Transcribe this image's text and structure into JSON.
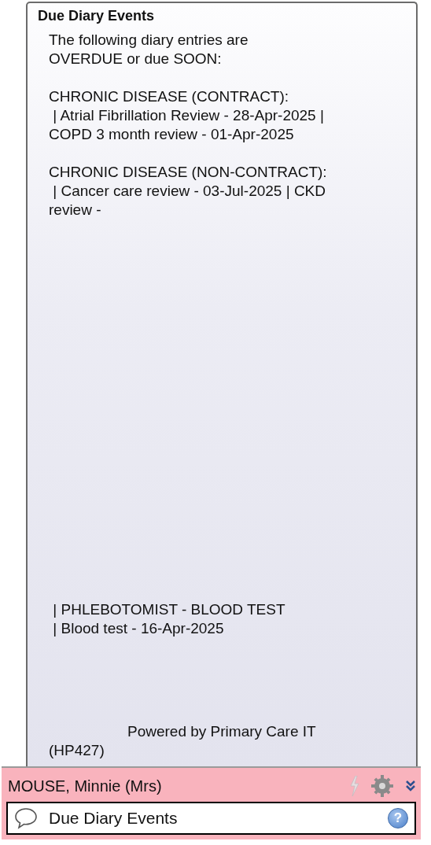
{
  "popup": {
    "title": "Due Diary Events",
    "sections": [
      {
        "lines": [
          "The following diary entries are",
          "OVERDUE or due SOON:"
        ]
      },
      {
        "lines": [
          "CHRONIC DISEASE (CONTRACT):",
          " | Atrial Fibrillation Review - 28-Apr-2025 |",
          "COPD 3 month review - 01-Apr-2025"
        ]
      },
      {
        "lines": [
          "CHRONIC DISEASE (NON-CONTRACT):",
          " | Cancer care review - 03-Jul-2025 | CKD",
          "review -"
        ]
      },
      {
        "lines": [
          " | PHLEBOTOMIST - BLOOD TEST",
          " | Blood test - 16-Apr-2025"
        ]
      }
    ],
    "footer": "Powered by Primary Care IT (HP427)"
  },
  "patient_bar": {
    "name": "MOUSE, Minnie (Mrs)",
    "alert_label": "Due Diary Events",
    "help_glyph": "?"
  }
}
